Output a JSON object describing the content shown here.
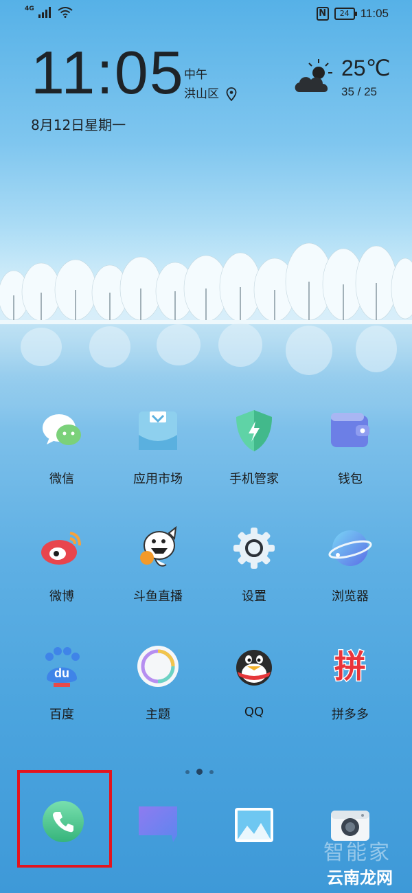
{
  "status_bar": {
    "network": "4G",
    "nfc_label": "N",
    "battery": "24",
    "time": "11:05"
  },
  "clock": {
    "time": "11:05",
    "period": "中午",
    "location": "洪山区",
    "date": "8月12日星期一"
  },
  "weather": {
    "icon": "partly-cloudy-icon",
    "temperature": "25℃",
    "range": "35 / 25"
  },
  "apps": [
    {
      "label": "微信",
      "icon": "wechat-icon"
    },
    {
      "label": "应用市场",
      "icon": "app-market-icon"
    },
    {
      "label": "手机管家",
      "icon": "phone-manager-icon"
    },
    {
      "label": "钱包",
      "icon": "wallet-icon"
    },
    {
      "label": "微博",
      "icon": "weibo-icon"
    },
    {
      "label": "斗鱼直播",
      "icon": "douyu-icon"
    },
    {
      "label": "设置",
      "icon": "settings-icon"
    },
    {
      "label": "浏览器",
      "icon": "browser-icon"
    },
    {
      "label": "百度",
      "icon": "baidu-icon"
    },
    {
      "label": "主题",
      "icon": "themes-icon"
    },
    {
      "label": "QQ",
      "icon": "qq-icon"
    },
    {
      "label": "拼多多",
      "icon": "pinduoduo-icon"
    }
  ],
  "pager": {
    "pages": 3,
    "active": 2
  },
  "dock": [
    {
      "name": "phone",
      "icon": "phone-icon"
    },
    {
      "name": "messages",
      "icon": "messages-icon"
    },
    {
      "name": "gallery",
      "icon": "gallery-icon"
    },
    {
      "name": "camera",
      "icon": "camera-icon"
    }
  ],
  "highlight_color": "#e3141e",
  "watermark": {
    "text": "云南龙网",
    "faint_text": "智能家"
  }
}
